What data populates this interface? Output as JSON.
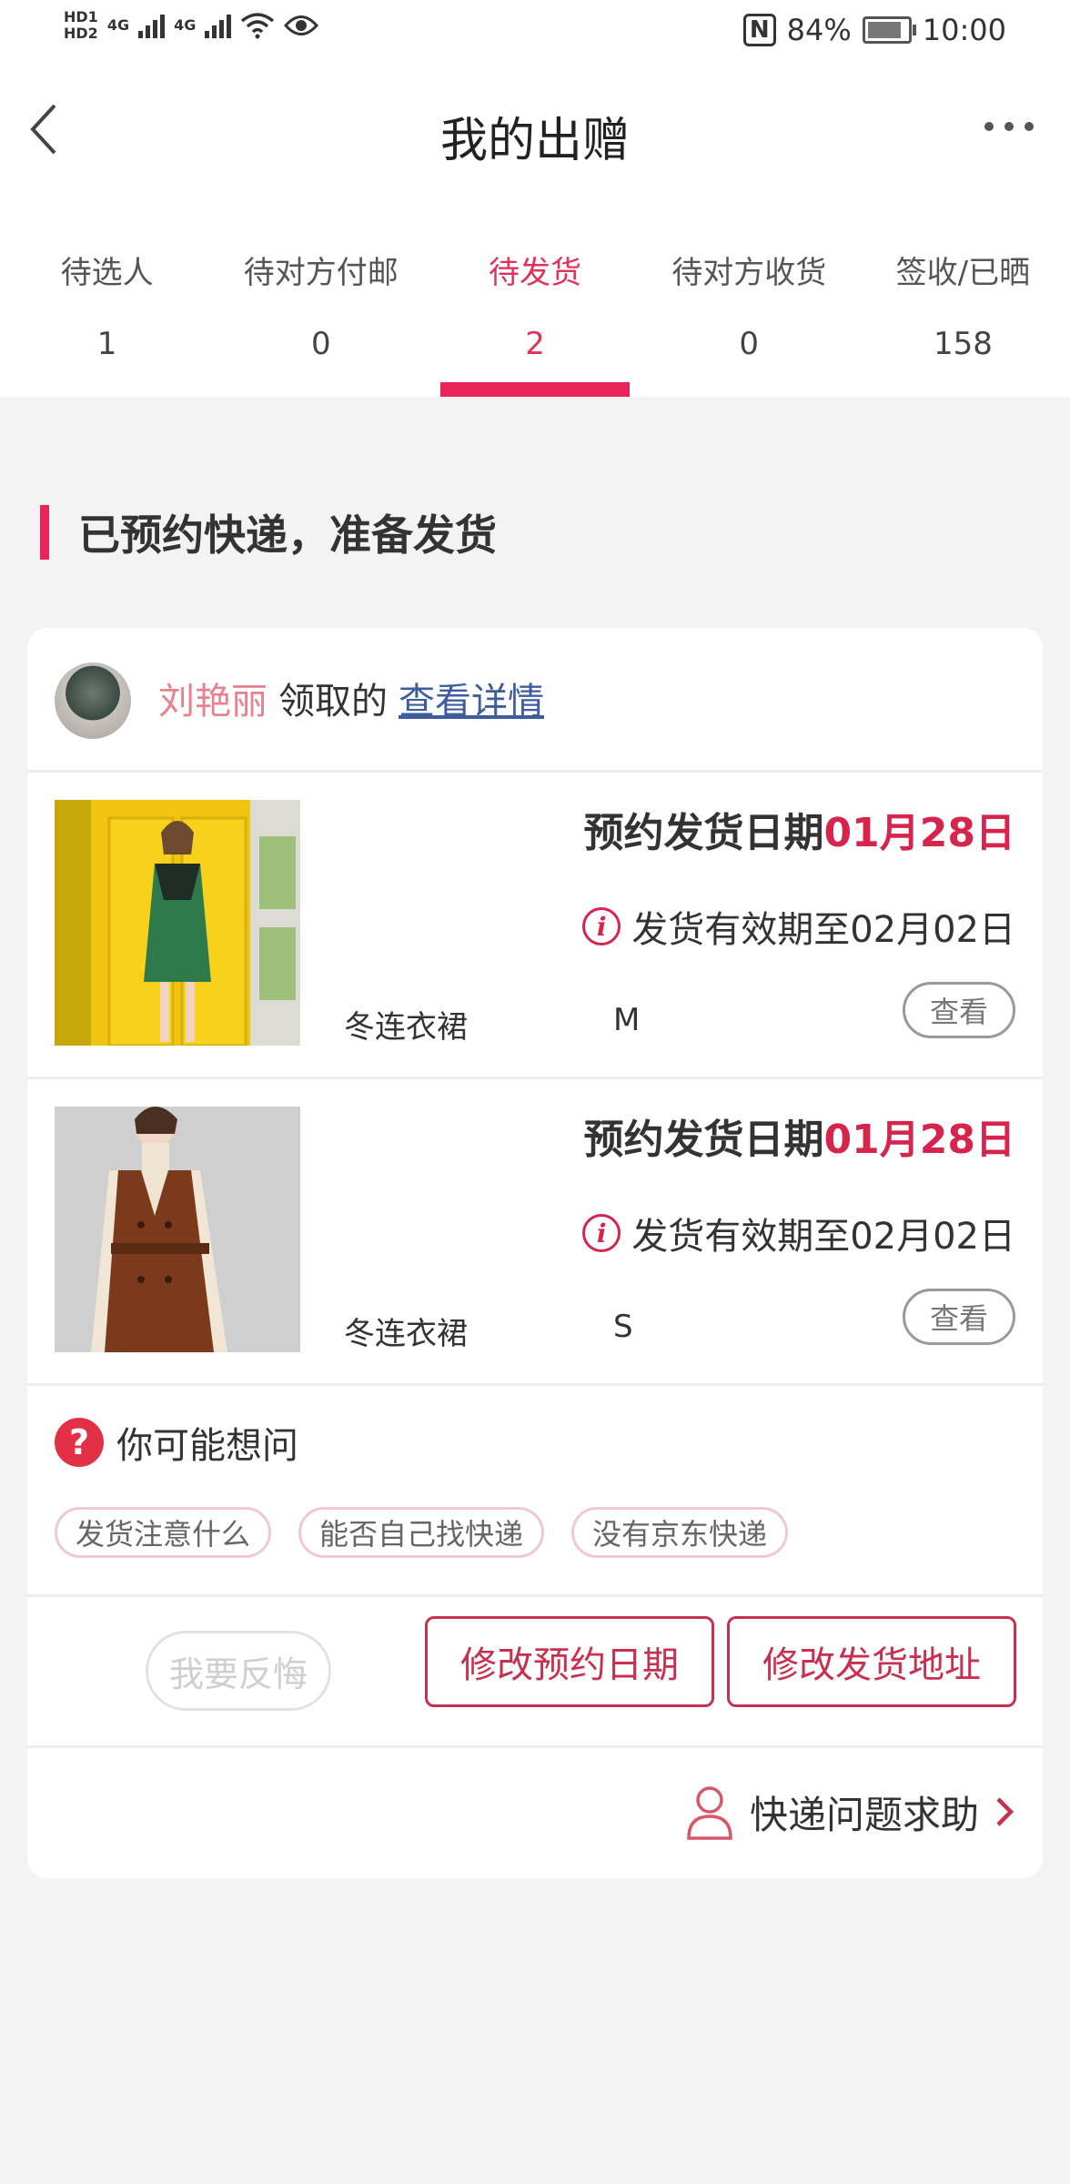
{
  "status_bar": {
    "hd1": "HD1",
    "hd2": "HD2",
    "net1": "4G",
    "net2": "4G",
    "battery_pct": "84%",
    "time": "10:00"
  },
  "nav": {
    "title": "我的出赠"
  },
  "tabs": [
    {
      "label": "待选人",
      "count": "1"
    },
    {
      "label": "待对方付邮",
      "count": "0"
    },
    {
      "label": "待发货",
      "count": "2"
    },
    {
      "label": "待对方收货",
      "count": "0"
    },
    {
      "label": "签收/已晒",
      "count": "158"
    }
  ],
  "section": {
    "title": "已预约快递，准备发货"
  },
  "order": {
    "user_name": "刘艳丽",
    "received_text": "领取的",
    "detail_link": "查看详情",
    "items": [
      {
        "date_label": "预约发货日期",
        "date_value": "01月28日",
        "valid_text": "发货有效期至02月02日",
        "name": "冬连衣裙",
        "size": "M",
        "view_label": "查看"
      },
      {
        "date_label": "预约发货日期",
        "date_value": "01月28日",
        "valid_text": "发货有效期至02月02日",
        "name": "冬连衣裙",
        "size": "S",
        "view_label": "查看"
      }
    ]
  },
  "faq": {
    "icon": "?",
    "title": "你可能想问",
    "chips": [
      "发货注意什么",
      "能否自己找快递",
      "没有京东快递"
    ]
  },
  "actions": {
    "regret": "我要反悔",
    "change_date": "修改预约日期",
    "change_address": "修改发货地址"
  },
  "help": {
    "label": "快递问题求助"
  },
  "colors": {
    "accent": "#e8245b",
    "date_red": "#d6244d",
    "link_blue": "#3f5c9c",
    "username_pink": "#e8828f"
  }
}
